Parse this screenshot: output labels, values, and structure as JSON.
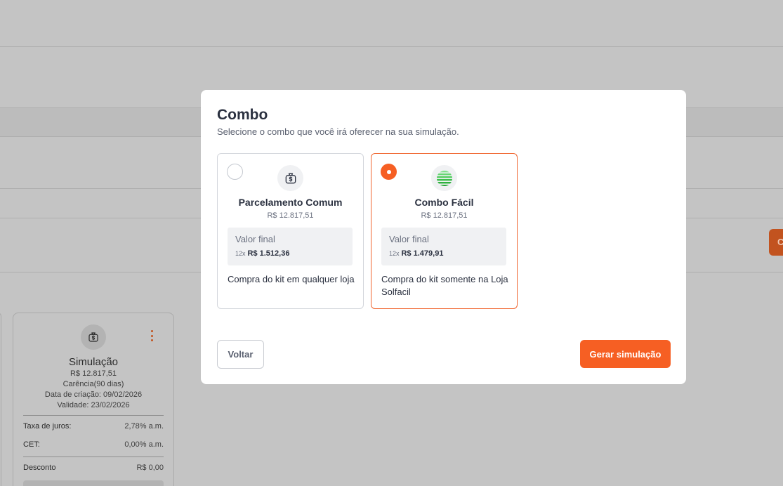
{
  "background": {
    "side_button_label": "C",
    "simulation_card": {
      "title": "Simulação",
      "price": "R$ 12.817,51",
      "grace": "Carência(90 dias)",
      "created": "Data de criação: 09/02/2026",
      "validity": "Validade: 23/02/2026",
      "rows": [
        {
          "label": "Taxa de juros:",
          "value": "2,78% a.m."
        },
        {
          "label": "CET:",
          "value": "0,00% a.m."
        },
        {
          "label": "Desconto",
          "value": "R$ 0,00"
        }
      ]
    }
  },
  "modal": {
    "title": "Combo",
    "subtitle": "Selecione o combo que você irá oferecer na sua simulação.",
    "options": [
      {
        "name": "Parcelamento Comum",
        "price": "R$ 12.817,51",
        "final_label": "Valor final",
        "installments": "12x",
        "installment_value": "R$ 1.512,36",
        "description": "Compra do kit em qualquer loja",
        "icon": "money-bag-icon",
        "selected": false
      },
      {
        "name": "Combo Fácil",
        "price": "R$ 12.817,51",
        "final_label": "Valor final",
        "installments": "12x",
        "installment_value": "R$ 1.479,91",
        "description": "Compra do kit somente na Loja Solfacil",
        "icon": "solfacil-logo-icon",
        "selected": true
      }
    ],
    "back_label": "Voltar",
    "generate_label": "Gerar simulação"
  },
  "colors": {
    "accent": "#f65f23",
    "overlay": "#c4c4c4"
  }
}
